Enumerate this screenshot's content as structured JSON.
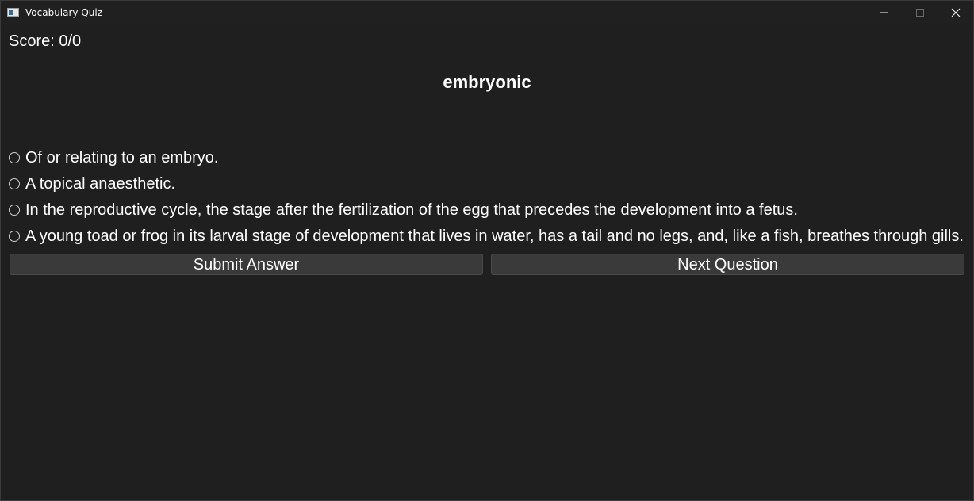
{
  "window": {
    "title": "Vocabulary Quiz"
  },
  "quiz": {
    "score_text": "Score: 0/0",
    "word": "embryonic",
    "options": [
      {
        "label": "Of or relating to an embryo."
      },
      {
        "label": "A topical anaesthetic."
      },
      {
        "label": "In the reproductive cycle, the stage after the fertilization of the egg that precedes the development into a fetus."
      },
      {
        "label": "A young toad or frog in its larval stage of development that lives in water, has a tail and no legs, and, like a fish, breathes through gills."
      }
    ],
    "submit_label": "Submit Answer",
    "next_label": "Next Question"
  },
  "colors": {
    "background": "#1f1f1f",
    "button": "#3a3a3a",
    "text": "#ffffff"
  }
}
